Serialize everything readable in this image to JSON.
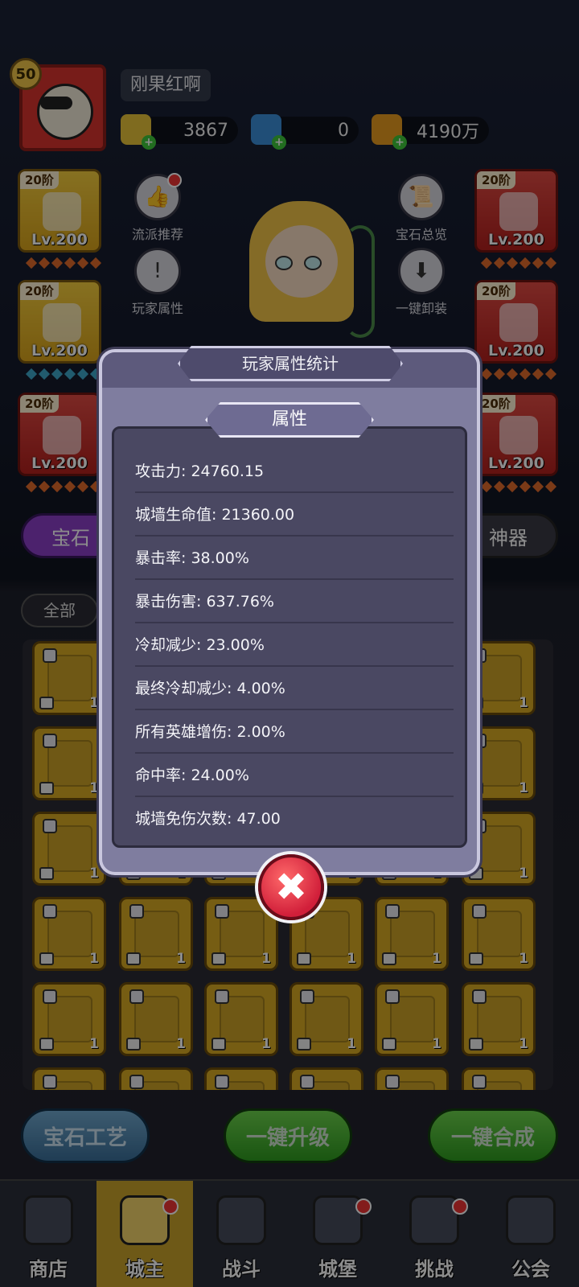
{
  "player": {
    "level": "50",
    "name": "刚果红啊"
  },
  "resources": [
    {
      "icon": "gold-coin-icon",
      "value": "3867"
    },
    {
      "icon": "potion-icon",
      "value": "0"
    },
    {
      "icon": "gold-coin-stack-icon",
      "value": "4190万"
    }
  ],
  "equipment_left": [
    {
      "tier": "20阶",
      "level": "Lv.200",
      "icon": "wizard-hat-icon"
    },
    {
      "tier": "20阶",
      "level": "Lv.200",
      "icon": "armor-icon"
    },
    {
      "tier": "20阶",
      "level": "Lv.200",
      "icon": "boots-icon"
    }
  ],
  "equipment_right": [
    {
      "tier": "20阶",
      "level": "Lv.200",
      "icon": "staff-icon"
    },
    {
      "tier": "20阶",
      "level": "Lv.200",
      "icon": "ring-icon"
    },
    {
      "tier": "20阶",
      "level": "Lv.200",
      "icon": "necklace-icon"
    }
  ],
  "side_buttons": {
    "recommend": "流派推荐",
    "attributes": "玩家属性",
    "gem_overview": "宝石总览",
    "unequip_all": "一键卸装"
  },
  "tabs": {
    "gem": "宝石",
    "artifact": "神器"
  },
  "filter": "全部",
  "actions": {
    "craft": "宝石工艺",
    "upgrade": "一键升级",
    "merge": "一键合成"
  },
  "nav": [
    {
      "label": "商店",
      "icon": "shop-icon"
    },
    {
      "label": "城主",
      "icon": "crown-icon",
      "active": true
    },
    {
      "label": "战斗",
      "icon": "swords-icon"
    },
    {
      "label": "城堡",
      "icon": "castle-icon"
    },
    {
      "label": "挑战",
      "icon": "devil-icon"
    },
    {
      "label": "公会",
      "icon": "banner-icon"
    }
  ],
  "modal": {
    "title": "玩家属性统计",
    "section": "属性",
    "stats": [
      "攻击力: 24760.15",
      "城墙生命值: 21360.00",
      "暴击率: 38.00%",
      "暴击伤害: 637.76%",
      "冷却减少: 23.00%",
      "最终冷却减少: 4.00%",
      "所有英雄增伤: 2.00%",
      "命中率: 24.00%",
      "城墙免伤次数: 47.00"
    ],
    "close": "✖"
  },
  "gem_count": "1"
}
